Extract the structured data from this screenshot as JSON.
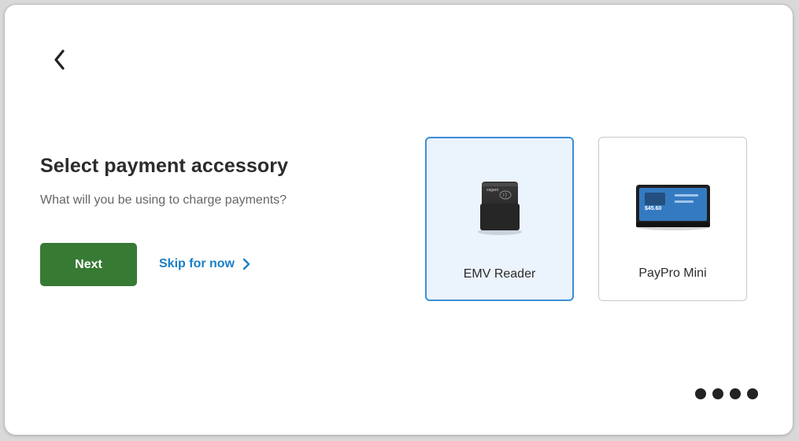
{
  "header": {
    "back_icon": "chevron-left-icon"
  },
  "main": {
    "title": "Select payment accessory",
    "subtitle": "What will you be using to charge payments?",
    "next_label": "Next",
    "skip_label": "Skip for now",
    "skip_icon": "chevron-right-icon"
  },
  "accessories": [
    {
      "label": "EMV Reader",
      "selected": true,
      "brand_text": "vagaro"
    },
    {
      "label": "PayPro Mini",
      "selected": false,
      "screen_amount": "$45.60"
    }
  ],
  "pagination": {
    "total": 4
  },
  "colors": {
    "primary_button": "#377a34",
    "link": "#1a7fc6",
    "selected_border": "#3b8fd6",
    "selected_bg": "#ebf3fc"
  }
}
